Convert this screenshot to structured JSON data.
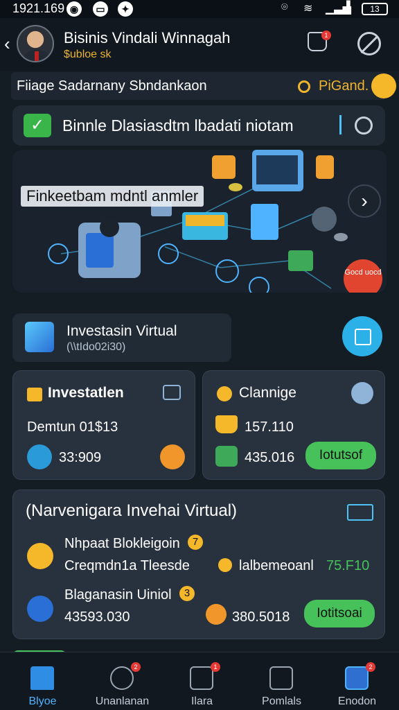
{
  "status_bar": {
    "time": "1921.169",
    "battery": "13"
  },
  "header": {
    "title": "Bisinis Vindali Winnagah",
    "subtitle": "$ubloe sk",
    "cart_badge": "1"
  },
  "subbar": {
    "left_text": "Fiiage Sadarnany Sbndankaon",
    "right_text": "PiGand."
  },
  "search": {
    "text": "Binnle Dlasiasdtm lbadati niotam"
  },
  "hero": {
    "label": "Finkeetbam mdntl anmler",
    "badge": "Gocd uocd"
  },
  "investasi": {
    "title": "Investasin Virtual",
    "subtitle": "(\\\\tIdo02i30)"
  },
  "card_investatlen": {
    "title": "Investatlen",
    "row1": "Demtun 01$13",
    "row2": "33:909"
  },
  "card_clanige": {
    "title": "Clannige",
    "row1": "157.110",
    "row2": "435.016",
    "button": "Iotutsof"
  },
  "card_nav": {
    "title": "(Narvenigara Invehai Virtual)",
    "item1": {
      "title": "Nhpaat Blokleigoin",
      "badge": "7",
      "sub": "Creqmdn1a Tleesde",
      "right_label": "lalbemeoanl",
      "right_value": "75.F10"
    },
    "item2": {
      "title": "Blaganasin Uiniol",
      "badge": "3",
      "sub": "43593.030",
      "value": "380.5018",
      "button": "Iotitsoai"
    }
  },
  "bottom_nav": [
    {
      "label": "Blyoe",
      "active": true
    },
    {
      "label": "Unanlanan",
      "badge": "2"
    },
    {
      "label": "Ilara",
      "badge": "1"
    },
    {
      "label": "Pomlals"
    },
    {
      "label": "Enodon",
      "badge": "2"
    }
  ],
  "colors": {
    "accent_green": "#47c25a",
    "accent_gold": "#f5b82a",
    "accent_blue": "#2bb0e8"
  }
}
